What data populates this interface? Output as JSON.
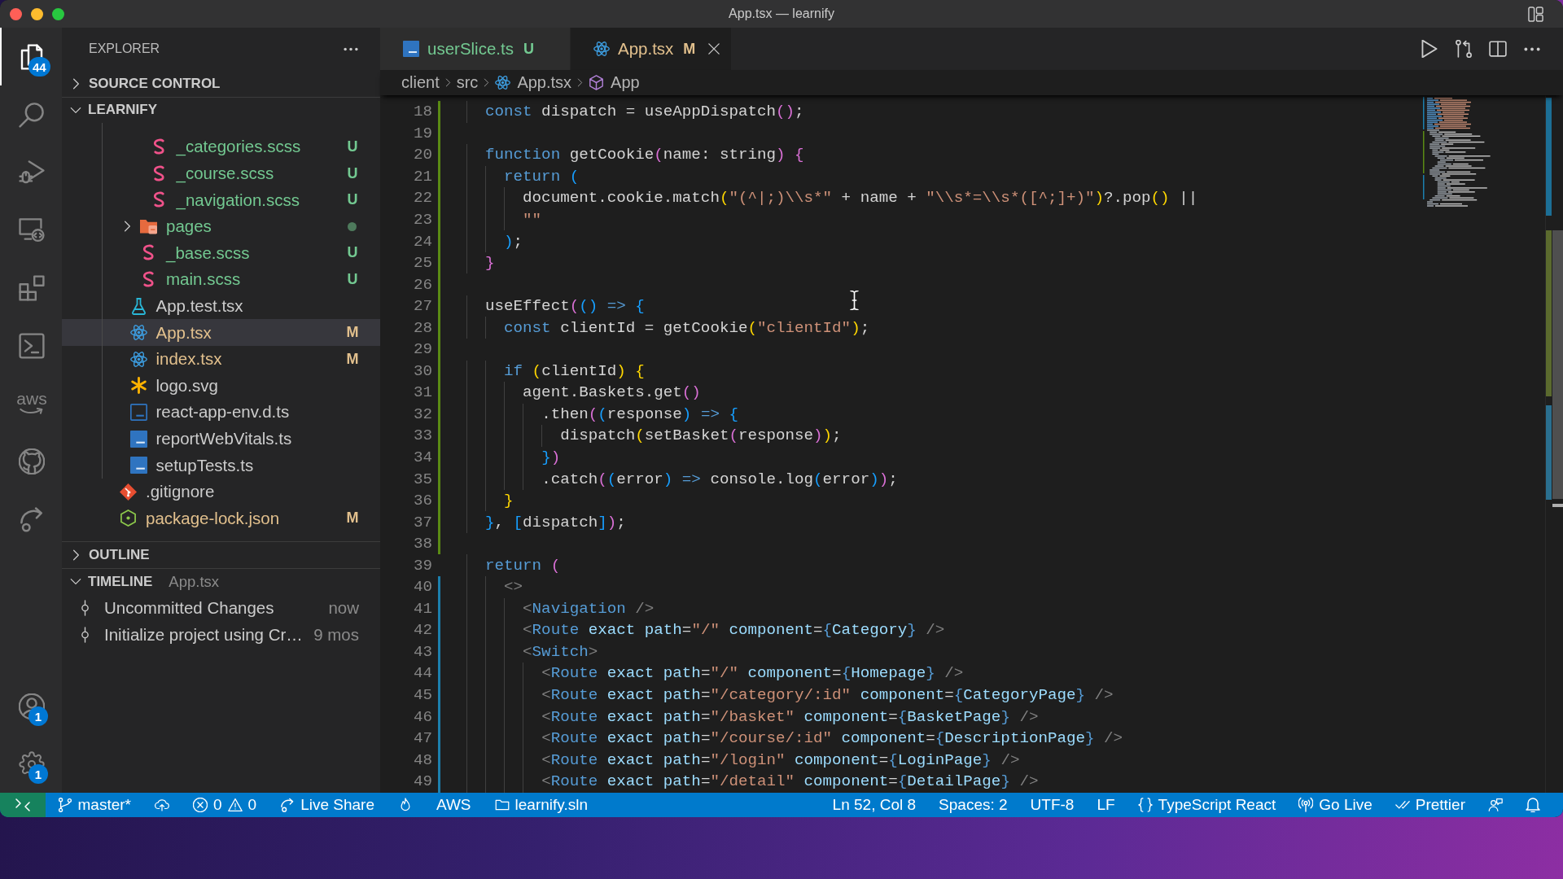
{
  "window": {
    "title": "App.tsx — learnify"
  },
  "activity_bar": {
    "top": [
      {
        "kind": "files",
        "selected": true,
        "badge": "44"
      },
      {
        "kind": "search",
        "selected": false
      },
      {
        "kind": "run-debug",
        "selected": false
      },
      {
        "kind": "remote",
        "selected": false
      },
      {
        "kind": "extensions",
        "selected": false
      },
      {
        "kind": "terminal",
        "selected": false
      },
      {
        "kind": "aws",
        "label": "aws",
        "selected": false
      },
      {
        "kind": "github",
        "selected": false
      },
      {
        "kind": "live-share",
        "selected": false
      }
    ],
    "bottom": [
      {
        "kind": "account",
        "badge": "1"
      },
      {
        "kind": "settings",
        "badge": "1"
      }
    ]
  },
  "sidebar": {
    "title": "EXPLORER",
    "sections": [
      {
        "title": "SOURCE CONTROL",
        "expanded": false
      },
      {
        "title": "LEARNIFY",
        "expanded": true,
        "tree": [
          {
            "children": [
              {
                "children": [
                  {
                    "children": [
                      {
                        "label": "_categories.scss",
                        "kind": "scss",
                        "color": "#73c991",
                        "badge": "U",
                        "selected": false
                      },
                      {
                        "label": "_course.scss",
                        "kind": "scss",
                        "color": "#73c991",
                        "badge": "U",
                        "selected": false
                      },
                      {
                        "label": "_navigation.scss",
                        "kind": "scss",
                        "color": "#73c991",
                        "badge": "U",
                        "selected": false
                      }
                    ]
                  },
                  {
                    "label": "pages",
                    "kind": "folder-pages",
                    "expanded": false,
                    "color": "#73c991",
                    "dot": {
                      "color": "#4e7a5c"
                    },
                    "selected": false
                  },
                  {
                    "label": "_base.scss",
                    "kind": "scss",
                    "color": "#73c991",
                    "badge": "U",
                    "selected": false
                  },
                  {
                    "label": "main.scss",
                    "kind": "scss",
                    "color": "#73c991",
                    "badge": "U",
                    "selected": false
                  }
                ]
              },
              {
                "label": "App.test.tsx",
                "kind": "test",
                "color": "#cccccc",
                "selected": false
              },
              {
                "label": "App.tsx",
                "kind": "react",
                "color": "#e2c08d",
                "badge": "M",
                "selected": true
              },
              {
                "label": "index.tsx",
                "kind": "react",
                "color": "#e2c08d",
                "badge": "M",
                "selected": false
              },
              {
                "label": "logo.svg",
                "kind": "svg",
                "color": "#cccccc",
                "selected": false
              },
              {
                "label": "react-app-env.d.ts",
                "kind": "ts-declaration",
                "color": "#cccccc",
                "selected": false
              },
              {
                "label": "reportWebVitals.ts",
                "kind": "ts",
                "color": "#cccccc",
                "selected": false
              },
              {
                "label": "setupTests.ts",
                "kind": "ts",
                "color": "#cccccc",
                "selected": false
              }
            ]
          },
          {
            "label": ".gitignore",
            "kind": "git",
            "color": "#cccccc",
            "selected": false
          },
          {
            "label": "package-lock.json",
            "kind": "node",
            "color": "#e2c08d",
            "badge": "M",
            "selected": false
          }
        ]
      },
      {
        "title": "OUTLINE",
        "expanded": false
      },
      {
        "title": "TIMELINE",
        "expanded": true,
        "subtitle": "App.tsx",
        "entries": [
          {
            "label": "Uncommitted Changes",
            "time": "now"
          },
          {
            "label": "Initialize project using Cr…",
            "time": "9 mos"
          }
        ]
      }
    ]
  },
  "editor": {
    "tabs": [
      {
        "label": "userSlice.ts",
        "kind": "ts",
        "color": "#73c991",
        "badge": "U",
        "selected": false
      },
      {
        "label": "App.tsx",
        "kind": "react",
        "color": "#e2c08d",
        "badge": "M",
        "selected": true
      }
    ],
    "actions": [
      {
        "kind": "run"
      },
      {
        "kind": "compare"
      },
      {
        "kind": "split"
      },
      {
        "kind": "more"
      }
    ],
    "breadcrumb": [
      {
        "label": "client"
      },
      {
        "label": "src"
      },
      {
        "label": "App.tsx",
        "kind": "react"
      },
      {
        "label": "App",
        "kind": "symbol"
      }
    ],
    "lines": [
      {
        "n": "18",
        "color": "#5a8a14",
        "tokens": [
          {
            "kind": "keyword",
            "text": "  const"
          },
          {
            "kind": "text",
            "text": " dispatch = useAppDispatch"
          },
          {
            "kind": "bracket2",
            "text": "()"
          },
          {
            "kind": "text",
            "text": ";"
          }
        ]
      },
      {
        "n": "19",
        "color": "#5a8a14"
      },
      {
        "n": "20",
        "color": "#5a8a14",
        "tokens": [
          {
            "kind": "keyword",
            "text": "  function"
          },
          {
            "kind": "text",
            "text": " getCookie"
          },
          {
            "kind": "bracket2",
            "text": "("
          },
          {
            "kind": "text",
            "text": "name: string"
          },
          {
            "kind": "bracket2",
            "text": ")"
          },
          {
            "kind": "bracket2",
            "text": " {"
          }
        ]
      },
      {
        "n": "21",
        "color": "#5a8a14",
        "tokens": [
          {
            "kind": "keyword",
            "text": "    return"
          },
          {
            "kind": "bracket3",
            "text": " ("
          }
        ]
      },
      {
        "n": "22",
        "color": "#5a8a14",
        "tokens": [
          {
            "kind": "text",
            "text": "      document.cookie.match"
          },
          {
            "kind": "bracket1",
            "text": "("
          },
          {
            "kind": "string",
            "text": "\"(^|;)\\\\s*\""
          },
          {
            "kind": "text",
            "text": " + name + "
          },
          {
            "kind": "string",
            "text": "\"\\\\s*=\\\\s*([^;]+)\""
          },
          {
            "kind": "bracket1",
            "text": ")"
          },
          {
            "kind": "text",
            "text": "?.pop"
          },
          {
            "kind": "bracket1",
            "text": "()"
          },
          {
            "kind": "text",
            "text": " ||"
          }
        ]
      },
      {
        "n": "23",
        "color": "#5a8a14",
        "tokens": [
          {
            "kind": "string",
            "text": "      \"\""
          }
        ]
      },
      {
        "n": "24",
        "color": "#5a8a14",
        "tokens": [
          {
            "kind": "bracket3",
            "text": "    )"
          },
          {
            "kind": "text",
            "text": ";"
          }
        ]
      },
      {
        "n": "25",
        "color": "#5a8a14",
        "tokens": [
          {
            "kind": "bracket2",
            "text": "  }"
          }
        ]
      },
      {
        "n": "26",
        "color": "#5a8a14"
      },
      {
        "n": "27",
        "color": "#5a8a14",
        "tokens": [
          {
            "kind": "text",
            "text": "  useEffect"
          },
          {
            "kind": "bracket2",
            "text": "("
          },
          {
            "kind": "bracket3",
            "text": "()"
          },
          {
            "kind": "keyword",
            "text": " =>"
          },
          {
            "kind": "bracket3",
            "text": " {"
          }
        ]
      },
      {
        "n": "28",
        "color": "#5a8a14",
        "tokens": [
          {
            "kind": "keyword",
            "text": "    const"
          },
          {
            "kind": "text",
            "text": " clientId = getCookie"
          },
          {
            "kind": "bracket1",
            "text": "("
          },
          {
            "kind": "string",
            "text": "\"clientId\""
          },
          {
            "kind": "bracket1",
            "text": ")"
          },
          {
            "kind": "text",
            "text": ";"
          }
        ]
      },
      {
        "n": "29",
        "color": "#5a8a14"
      },
      {
        "n": "30",
        "color": "#5a8a14",
        "tokens": [
          {
            "kind": "keyword",
            "text": "    if"
          },
          {
            "kind": "bracket1",
            "text": " ("
          },
          {
            "kind": "text",
            "text": "clientId"
          },
          {
            "kind": "bracket1",
            "text": ")"
          },
          {
            "kind": "bracket1",
            "text": " {"
          }
        ]
      },
      {
        "n": "31",
        "color": "#5a8a14",
        "tokens": [
          {
            "kind": "text",
            "text": "      agent.Baskets.get"
          },
          {
            "kind": "bracket2",
            "text": "()"
          }
        ]
      },
      {
        "n": "32",
        "color": "#5a8a14",
        "tokens": [
          {
            "kind": "text",
            "text": "        .then"
          },
          {
            "kind": "bracket2",
            "text": "("
          },
          {
            "kind": "bracket3",
            "text": "("
          },
          {
            "kind": "text",
            "text": "response"
          },
          {
            "kind": "bracket3",
            "text": ")"
          },
          {
            "kind": "keyword",
            "text": " =>"
          },
          {
            "kind": "bracket3",
            "text": " {"
          }
        ]
      },
      {
        "n": "33",
        "color": "#5a8a14",
        "tokens": [
          {
            "kind": "text",
            "text": "          dispatch"
          },
          {
            "kind": "bracket1",
            "text": "("
          },
          {
            "kind": "text",
            "text": "setBasket"
          },
          {
            "kind": "bracket2",
            "text": "("
          },
          {
            "kind": "text",
            "text": "response"
          },
          {
            "kind": "bracket2",
            "text": ")"
          },
          {
            "kind": "bracket1",
            "text": ")"
          },
          {
            "kind": "text",
            "text": ";"
          }
        ]
      },
      {
        "n": "34",
        "color": "#5a8a14",
        "tokens": [
          {
            "kind": "bracket3",
            "text": "        }"
          },
          {
            "kind": "bracket2",
            "text": ")"
          }
        ]
      },
      {
        "n": "35",
        "color": "#5a8a14",
        "tokens": [
          {
            "kind": "text",
            "text": "        .catch"
          },
          {
            "kind": "bracket2",
            "text": "("
          },
          {
            "kind": "bracket3",
            "text": "("
          },
          {
            "kind": "text",
            "text": "error"
          },
          {
            "kind": "bracket3",
            "text": ")"
          },
          {
            "kind": "keyword",
            "text": " =>"
          },
          {
            "kind": "text",
            "text": " console.log"
          },
          {
            "kind": "bracket3",
            "text": "("
          },
          {
            "kind": "text",
            "text": "error"
          },
          {
            "kind": "bracket3",
            "text": ")"
          },
          {
            "kind": "bracket2",
            "text": ")"
          },
          {
            "kind": "text",
            "text": ";"
          }
        ]
      },
      {
        "n": "36",
        "color": "#5a8a14",
        "tokens": [
          {
            "kind": "bracket1",
            "text": "    }"
          }
        ]
      },
      {
        "n": "37",
        "color": "#5a8a14",
        "tokens": [
          {
            "kind": "bracket3",
            "text": "  }"
          },
          {
            "kind": "text",
            "text": ", "
          },
          {
            "kind": "bracket3",
            "text": "["
          },
          {
            "kind": "text",
            "text": "dispatch"
          },
          {
            "kind": "bracket3",
            "text": "]"
          },
          {
            "kind": "bracket2",
            "text": ")"
          },
          {
            "kind": "text",
            "text": ";"
          }
        ]
      },
      {
        "n": "38",
        "color": "#5a8a14"
      },
      {
        "n": "39",
        "tokens": [
          {
            "kind": "keyword",
            "text": "  return"
          },
          {
            "kind": "bracket2",
            "text": " ("
          }
        ]
      },
      {
        "n": "40",
        "color": "#1c7fad",
        "tokens": [
          {
            "kind": "tag-mark",
            "text": "    <>"
          }
        ]
      },
      {
        "n": "41",
        "color": "#1c7fad",
        "tokens": [
          {
            "kind": "tag-mark",
            "text": "      <"
          },
          {
            "kind": "tag",
            "text": "Navigation"
          },
          {
            "kind": "tag-mark",
            "text": " />"
          }
        ]
      },
      {
        "n": "42",
        "color": "#1c7fad",
        "tokens": [
          {
            "kind": "tag-mark",
            "text": "      <"
          },
          {
            "kind": "tag",
            "text": "Route"
          },
          {
            "kind": "attribute",
            "text": " exact path"
          },
          {
            "kind": "text",
            "text": "="
          },
          {
            "kind": "string",
            "text": "\"/\""
          },
          {
            "kind": "attribute",
            "text": " component"
          },
          {
            "kind": "text",
            "text": "="
          },
          {
            "kind": "brace",
            "text": "{"
          },
          {
            "kind": "variable",
            "text": "Category"
          },
          {
            "kind": "brace",
            "text": "}"
          },
          {
            "kind": "tag-mark",
            "text": " />"
          }
        ]
      },
      {
        "n": "43",
        "color": "#1c7fad",
        "tokens": [
          {
            "kind": "tag-mark",
            "text": "      <"
          },
          {
            "kind": "tag",
            "text": "Switch"
          },
          {
            "kind": "tag-mark",
            "text": ">"
          }
        ]
      },
      {
        "n": "44",
        "color": "#1c7fad",
        "tokens": [
          {
            "kind": "tag-mark",
            "text": "        <"
          },
          {
            "kind": "tag",
            "text": "Route"
          },
          {
            "kind": "attribute",
            "text": " exact path"
          },
          {
            "kind": "text",
            "text": "="
          },
          {
            "kind": "string",
            "text": "\"/\""
          },
          {
            "kind": "attribute",
            "text": " component"
          },
          {
            "kind": "text",
            "text": "="
          },
          {
            "kind": "brace",
            "text": "{"
          },
          {
            "kind": "variable",
            "text": "Homepage"
          },
          {
            "kind": "brace",
            "text": "}"
          },
          {
            "kind": "tag-mark",
            "text": " />"
          }
        ]
      },
      {
        "n": "45",
        "color": "#1c7fad",
        "tokens": [
          {
            "kind": "tag-mark",
            "text": "        <"
          },
          {
            "kind": "tag",
            "text": "Route"
          },
          {
            "kind": "attribute",
            "text": " exact path"
          },
          {
            "kind": "text",
            "text": "="
          },
          {
            "kind": "string",
            "text": "\"/category/:id\""
          },
          {
            "kind": "attribute",
            "text": " component"
          },
          {
            "kind": "text",
            "text": "="
          },
          {
            "kind": "brace",
            "text": "{"
          },
          {
            "kind": "variable",
            "text": "CategoryPage"
          },
          {
            "kind": "brace",
            "text": "}"
          },
          {
            "kind": "tag-mark",
            "text": " />"
          }
        ]
      },
      {
        "n": "46",
        "color": "#1c7fad",
        "tokens": [
          {
            "kind": "tag-mark",
            "text": "        <"
          },
          {
            "kind": "tag",
            "text": "Route"
          },
          {
            "kind": "attribute",
            "text": " exact path"
          },
          {
            "kind": "text",
            "text": "="
          },
          {
            "kind": "string",
            "text": "\"/basket\""
          },
          {
            "kind": "attribute",
            "text": " component"
          },
          {
            "kind": "text",
            "text": "="
          },
          {
            "kind": "brace",
            "text": "{"
          },
          {
            "kind": "variable",
            "text": "BasketPage"
          },
          {
            "kind": "brace",
            "text": "}"
          },
          {
            "kind": "tag-mark",
            "text": " />"
          }
        ]
      },
      {
        "n": "47",
        "color": "#1c7fad",
        "tokens": [
          {
            "kind": "tag-mark",
            "text": "        <"
          },
          {
            "kind": "tag",
            "text": "Route"
          },
          {
            "kind": "attribute",
            "text": " exact path"
          },
          {
            "kind": "text",
            "text": "="
          },
          {
            "kind": "string",
            "text": "\"/course/:id\""
          },
          {
            "kind": "attribute",
            "text": " component"
          },
          {
            "kind": "text",
            "text": "="
          },
          {
            "kind": "brace",
            "text": "{"
          },
          {
            "kind": "variable",
            "text": "DescriptionPage"
          },
          {
            "kind": "brace",
            "text": "}"
          },
          {
            "kind": "tag-mark",
            "text": " />"
          }
        ]
      },
      {
        "n": "48",
        "color": "#1c7fad",
        "tokens": [
          {
            "kind": "tag-mark",
            "text": "        <"
          },
          {
            "kind": "tag",
            "text": "Route"
          },
          {
            "kind": "attribute",
            "text": " exact path"
          },
          {
            "kind": "text",
            "text": "="
          },
          {
            "kind": "string",
            "text": "\"/login\""
          },
          {
            "kind": "attribute",
            "text": " component"
          },
          {
            "kind": "text",
            "text": "="
          },
          {
            "kind": "brace",
            "text": "{"
          },
          {
            "kind": "variable",
            "text": "LoginPage"
          },
          {
            "kind": "brace",
            "text": "}"
          },
          {
            "kind": "tag-mark",
            "text": " />"
          }
        ]
      },
      {
        "n": "49",
        "color": "#1c7fad",
        "tokens": [
          {
            "kind": "tag-mark",
            "text": "        <"
          },
          {
            "kind": "tag",
            "text": "Route"
          },
          {
            "kind": "attribute",
            "text": " exact path"
          },
          {
            "kind": "text",
            "text": "="
          },
          {
            "kind": "string",
            "text": "\"/detail\""
          },
          {
            "kind": "attribute",
            "text": " component"
          },
          {
            "kind": "text",
            "text": "="
          },
          {
            "kind": "brace",
            "text": "{"
          },
          {
            "kind": "variable",
            "text": "DetailPage"
          },
          {
            "kind": "brace",
            "text": "}"
          },
          {
            "kind": "tag-mark",
            "text": " />"
          }
        ]
      }
    ]
  },
  "status_bar": {
    "left": [
      {
        "kind": "remote"
      },
      {
        "kind": "branch",
        "text": "master*"
      },
      {
        "kind": "sync"
      },
      {
        "kind": "problems",
        "errors": "0",
        "warnings": "0"
      },
      {
        "kind": "live-share",
        "text": "Live Share"
      },
      {
        "kind": "flame"
      },
      {
        "kind": "aws",
        "text": "AWS"
      },
      {
        "kind": "solution",
        "text": "learnify.sln"
      }
    ],
    "right": [
      {
        "kind": "position",
        "text": "Ln 52, Col 8"
      },
      {
        "kind": "indent",
        "text": "Spaces: 2"
      },
      {
        "kind": "encoding",
        "text": "UTF-8"
      },
      {
        "kind": "eol",
        "text": "LF"
      },
      {
        "kind": "language",
        "text": "TypeScript React"
      },
      {
        "kind": "go-live",
        "text": "Go Live"
      },
      {
        "kind": "prettier",
        "text": "Prettier"
      },
      {
        "kind": "feedback"
      },
      {
        "kind": "notifications"
      }
    ]
  }
}
